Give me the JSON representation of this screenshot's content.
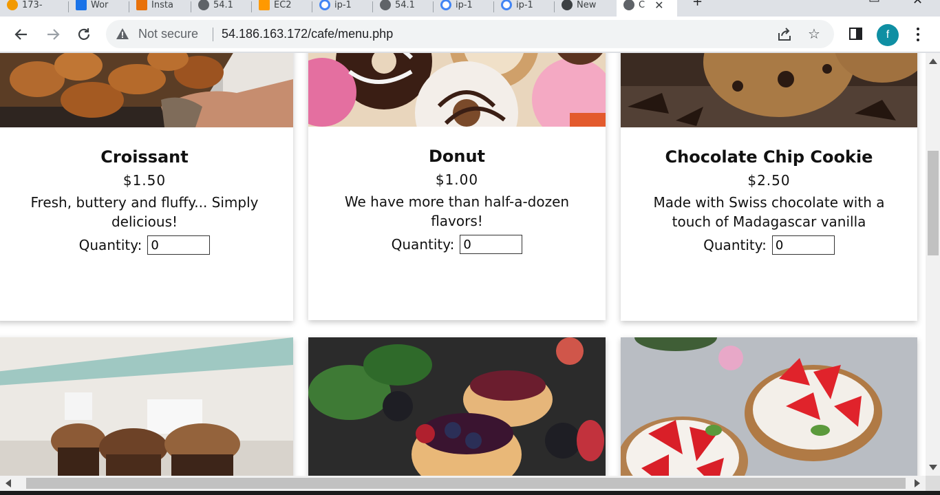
{
  "browser": {
    "tabs": [
      {
        "label": "173-",
        "icon": "wordpress-icon",
        "color": "#f29900"
      },
      {
        "label": "Wor",
        "icon": "vscode-icon",
        "color": "#1a73e8"
      },
      {
        "label": "Insta",
        "icon": "instance-icon",
        "color": "#e8710a"
      },
      {
        "label": "54.1",
        "icon": "globe-icon",
        "color": "#5f6368"
      },
      {
        "label": "EC2",
        "icon": "aws-icon",
        "color": "#ff9900"
      },
      {
        "label": "ip-1",
        "icon": "google-icon",
        "color": "#4285f4"
      },
      {
        "label": "54.1",
        "icon": "globe-icon",
        "color": "#5f6368"
      },
      {
        "label": "ip-1",
        "icon": "google-icon",
        "color": "#4285f4"
      },
      {
        "label": "ip-1",
        "icon": "google-icon",
        "color": "#4285f4"
      },
      {
        "label": "New",
        "icon": "chrome-icon",
        "color": "#3c4043"
      },
      {
        "label": "C",
        "icon": "globe-icon",
        "color": "#5f6368"
      }
    ],
    "security_label": "Not secure",
    "url": "54.186.163.172/cafe/menu.php",
    "profile_initial": "f",
    "profile_color": "#0f8fa3"
  },
  "menu": {
    "quantity_label": "Quantity:",
    "items": [
      {
        "name": "Croissant",
        "price": "$1.50",
        "description": "Fresh, buttery and fluffy... Simply delicious!",
        "quantity": "0",
        "image": "croissant-photo"
      },
      {
        "name": "Donut",
        "price": "$1.00",
        "description": "We have more than half-a-dozen flavors!",
        "quantity": "0",
        "image": "donut-photo"
      },
      {
        "name": "Chocolate Chip Cookie",
        "price": "$2.50",
        "description": "Made with Swiss chocolate with a touch of Madagascar vanilla",
        "quantity": "0",
        "image": "cookie-photo"
      }
    ],
    "next_row_images": [
      "muffin-photo",
      "berry-tart-photo",
      "strawberry-tart-photo"
    ]
  }
}
